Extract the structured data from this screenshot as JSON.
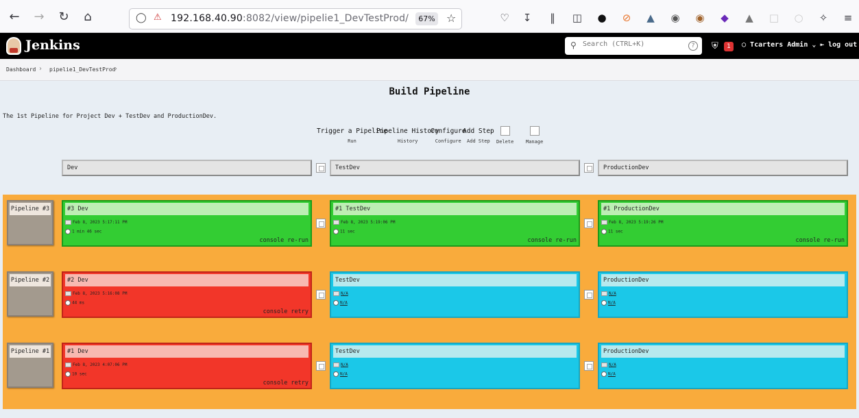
{
  "browser": {
    "url_host": "192.168.40.90",
    "url_port": ":8082",
    "url_path": "/view/pipelie1_DevTestProd/",
    "zoom": "67%"
  },
  "header": {
    "brand": "Jenkins",
    "search_placeholder": "Search (CTRL+K)",
    "notification_count": "1",
    "user": "Tcarters Admin",
    "logout": "log out"
  },
  "breadcrumb": [
    "Dashboard",
    "pipelie1_DevTestProd"
  ],
  "page": {
    "title": "Build Pipeline",
    "description": "The 1st Pipeline for Project Dev + TestDev and ProductionDev."
  },
  "actions": [
    {
      "label": "Trigger a Pipeline",
      "sub": "Run"
    },
    {
      "label": "Pipeline History",
      "sub": "History"
    },
    {
      "label": "Configure",
      "sub": "Configure"
    },
    {
      "label": "Add Step",
      "sub": "Add Step"
    },
    {
      "label": "",
      "sub": "Delete"
    },
    {
      "label": "",
      "sub": "Manage"
    }
  ],
  "stages": [
    "Dev",
    "TestDev",
    "ProductionDev"
  ],
  "pipelines": [
    {
      "label": "Pipeline #3",
      "cards": [
        {
          "title": "#3 Dev",
          "date": "Feb 8, 2023 5:17:11 PM",
          "duration": "1 min 46 sec",
          "links": [
            "console",
            "re-run"
          ],
          "status": "success"
        },
        {
          "title": "#1 TestDev",
          "date": "Feb 8, 2023 5:19:06 PM",
          "duration": "11 sec",
          "links": [
            "console",
            "re-run"
          ],
          "status": "success"
        },
        {
          "title": "#1 ProductionDev",
          "date": "Feb 8, 2023 5:19:26 PM",
          "duration": "11 sec",
          "links": [
            "console",
            "re-run"
          ],
          "status": "success"
        }
      ]
    },
    {
      "label": "Pipeline #2",
      "cards": [
        {
          "title": "#2 Dev",
          "date": "Feb 8, 2023 5:16:08 PM",
          "duration": "44 ms",
          "links": [
            "console",
            "retry"
          ],
          "status": "failed"
        },
        {
          "title": "TestDev",
          "date": "N/A",
          "duration": "N/A",
          "links": [],
          "status": "pending"
        },
        {
          "title": "ProductionDev",
          "date": "N/A",
          "duration": "N/A",
          "links": [],
          "status": "pending"
        }
      ]
    },
    {
      "label": "Pipeline #1",
      "cards": [
        {
          "title": "#1 Dev",
          "date": "Feb 8, 2023 4:07:06 PM",
          "duration": "10 sec",
          "links": [
            "console",
            "retry"
          ],
          "status": "failed"
        },
        {
          "title": "TestDev",
          "date": "N/A",
          "duration": "N/A",
          "links": [],
          "status": "pending"
        },
        {
          "title": "ProductionDev",
          "date": "N/A",
          "duration": "N/A",
          "links": [],
          "status": "pending"
        }
      ]
    }
  ],
  "colors": {
    "success": "#33cd33",
    "failed": "#f23629",
    "pending": "#1bc8e8",
    "pipeline_area": "#f9ab3c"
  }
}
